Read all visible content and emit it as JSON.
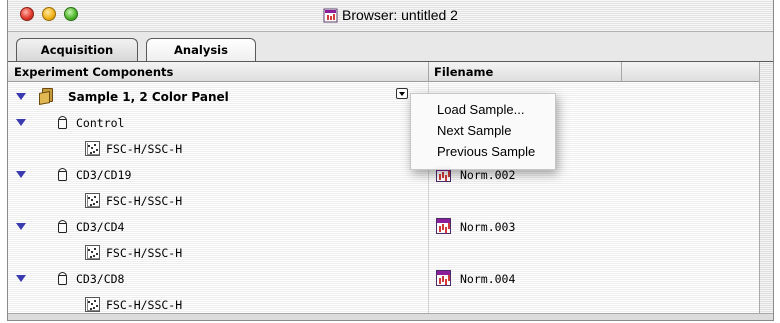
{
  "window": {
    "title": "Browser: untitled 2"
  },
  "tabs": [
    {
      "label": "Acquisition"
    },
    {
      "label": "Analysis"
    }
  ],
  "table": {
    "columns": [
      "Experiment Components",
      "Filename"
    ],
    "rows": [
      {
        "label": "Sample 1, 2 Color Panel",
        "filename": "",
        "icon": "folder-icon",
        "expanded": true
      },
      {
        "label": "Control",
        "filename": "",
        "icon": "tube-icon",
        "expanded": true
      },
      {
        "label": "FSC-H/SSC-H",
        "filename": "",
        "icon": "dot-plot-icon"
      },
      {
        "label": "CD3/CD19",
        "filename": "Norm.002",
        "icon": "tube-icon",
        "expanded": true
      },
      {
        "label": "FSC-H/SSC-H",
        "filename": "",
        "icon": "dot-plot-icon"
      },
      {
        "label": "CD3/CD4",
        "filename": "Norm.003",
        "icon": "tube-icon",
        "expanded": true
      },
      {
        "label": "FSC-H/SSC-H",
        "filename": "",
        "icon": "dot-plot-icon"
      },
      {
        "label": "CD3/CD8",
        "filename": "Norm.004",
        "icon": "tube-icon",
        "expanded": true
      },
      {
        "label": "FSC-H/SSC-H",
        "filename": "",
        "icon": "dot-plot-icon"
      }
    ]
  },
  "popup_menu": {
    "items": [
      "Load Sample...",
      "Next Sample",
      "Previous Sample"
    ]
  },
  "colors": {
    "disclosure": "#3a3ab0",
    "file_icon_header": "#8b1f9a"
  }
}
